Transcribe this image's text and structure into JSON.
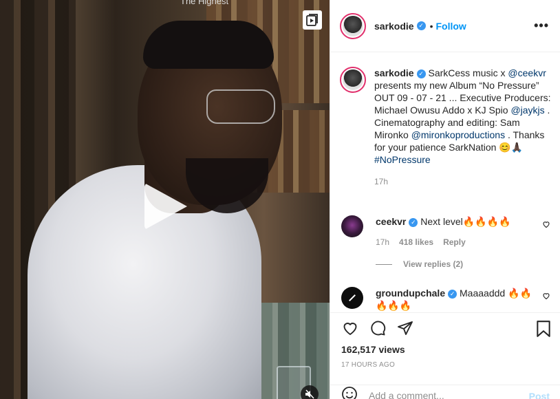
{
  "video": {
    "overlay_text": "The Highest",
    "play_icon": "play-icon",
    "multi_icon": "video-library-icon",
    "mute_icon": "muted-speaker-icon"
  },
  "header": {
    "username": "sarkodie",
    "separator": "•",
    "follow_label": "Follow",
    "more_label": "•••"
  },
  "caption": {
    "username": "sarkodie",
    "parts": {
      "t1": " SarkCess music x ",
      "m1": "@ceekvr",
      "t2": " presents my new Album “No Pressure” OUT 09 - 07 - 21 ... Executive Producers: Michael Owusu Addo x KJ Spio ",
      "m2": "@jaykjs",
      "t3": " . Cinematography and editing: Sam Mironko ",
      "m3": "@mironkoproductions",
      "t4": " . Thanks for your patience SarkNation 😊🙏🏿",
      "m4": "#NoPressure"
    },
    "time": "17h"
  },
  "comments": [
    {
      "username": "ceekvr",
      "text": " Next level🔥🔥🔥🔥",
      "time": "17h",
      "likes": "418 likes",
      "reply_label": "Reply"
    },
    {
      "username": "groundupchale",
      "text": " Maaaaddd 🔥🔥🔥🔥🔥"
    }
  ],
  "view_replies": "View replies (2)",
  "stats": {
    "views": "162,517 views",
    "ago": "17 HOURS AGO"
  },
  "add_comment": {
    "placeholder": "Add a comment...",
    "post_label": "Post"
  },
  "colors": {
    "accent": "#0095f6",
    "verified": "#3897f0",
    "mention": "#00376b",
    "muted": "#8e8e8e"
  }
}
